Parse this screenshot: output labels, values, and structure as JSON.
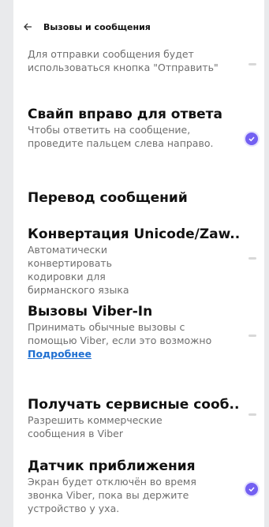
{
  "header": {
    "title": "Вызовы и сообщения"
  },
  "items": [
    {
      "title": "",
      "desc": "Для отправки сообщения будет использоваться кнопка \"Отправить\"",
      "state": "off"
    },
    {
      "title": "Свайп вправо для ответа",
      "desc": "Чтобы ответить на сообщение, проведите пальцем слева направо.",
      "state": "on"
    },
    {
      "title": "Перевод сообщений",
      "desc": "",
      "state": ""
    },
    {
      "title": "Конвертация Unicode/Zaw..",
      "desc": "Автоматически конвертировать кодировки для бирманского языка",
      "state": "off"
    },
    {
      "title": "Вызовы Viber-In",
      "desc": "Принимать обычные вызовы с помощью Viber, если это возможно",
      "link": "Подробнее",
      "state": "off"
    },
    {
      "title": "Получать сервисные сооб..",
      "desc": "Разрешить коммерческие сообщения в Viber",
      "state": "off"
    },
    {
      "title": "Датчик приближения",
      "desc": "Экран будет отключён во время звонка Viber, пока вы держите устройство у уха.",
      "state": "on"
    }
  ],
  "colors": {
    "accent": "#7360f2",
    "link": "#1f6fd1"
  },
  "icons": {
    "back": "arrow-left-icon",
    "checked": "check-icon"
  }
}
